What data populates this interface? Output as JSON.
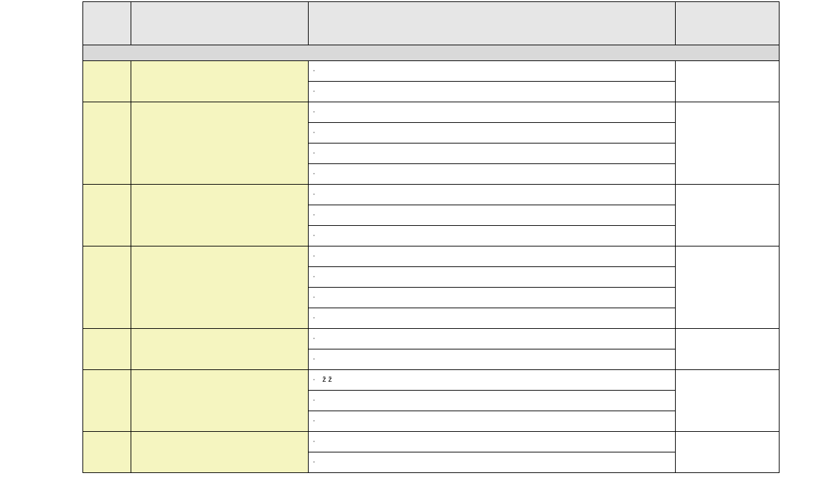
{
  "header": {
    "col1": "",
    "col2": "",
    "col3": "",
    "col4": ""
  },
  "section_label": "",
  "groups": [
    {
      "code": "",
      "label": "",
      "right": "",
      "items": [
        "",
        ""
      ]
    },
    {
      "code": "",
      "label": "",
      "right": "",
      "items": [
        "",
        "",
        "",
        ""
      ]
    },
    {
      "code": "",
      "label": "",
      "right": "",
      "items": [
        "",
        "",
        ""
      ]
    },
    {
      "code": "",
      "label": "",
      "right": "",
      "items": [
        "",
        "",
        "",
        ""
      ]
    },
    {
      "code": "",
      "label": "",
      "right": "",
      "items": [
        "",
        ""
      ]
    },
    {
      "code": "",
      "label": "",
      "right": "",
      "items": [
        "ž    ž",
        "",
        ""
      ]
    },
    {
      "code": "",
      "label": "",
      "right": "",
      "items": [
        "",
        ""
      ]
    }
  ]
}
